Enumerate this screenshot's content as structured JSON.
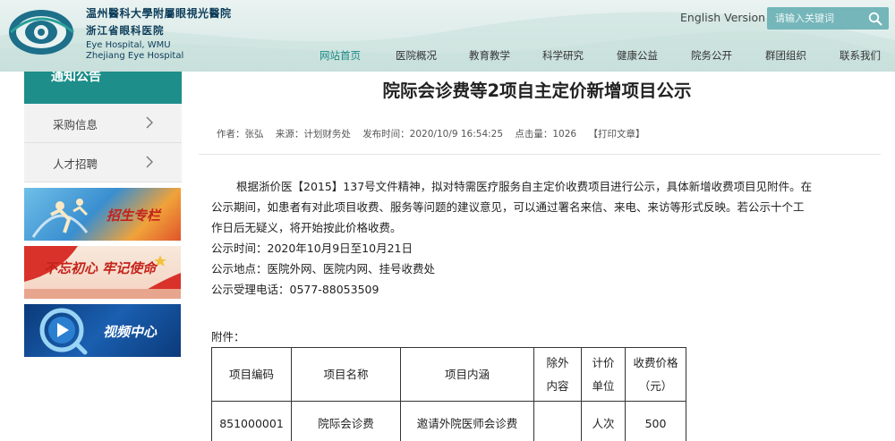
{
  "header": {
    "logo_cn_line1": "温州醫科大學附屬眼視光醫院",
    "logo_cn_line2": "浙江省眼科医院",
    "logo_en_line1": "Eye Hospital, WMU",
    "logo_en_line2": "Zhejiang Eye Hospital",
    "english_version": "English Version",
    "search_placeholder": "请输入关键词",
    "search_icon": "search-icon"
  },
  "nav": {
    "items": [
      "网站首页",
      "医院概况",
      "教育教学",
      "科学研究",
      "健康公益",
      "院务公开",
      "群团组织",
      "联系我们"
    ],
    "active_index": 0
  },
  "sidebar": {
    "heading": "通知公告",
    "items": [
      {
        "label": "采购信息"
      },
      {
        "label": "人才招聘"
      }
    ],
    "banners": [
      {
        "text": "招生专栏"
      },
      {
        "text": "不忘初心 牢记使命"
      },
      {
        "text": "视频中心"
      }
    ]
  },
  "article": {
    "title": "院际会诊费等2项自主定价新增项目公示",
    "meta": {
      "author": "作者：张弘",
      "source": "来源：计划财务处",
      "published": "发布时间：2020/10/9 16:54:25",
      "views": "点击量：1026",
      "print": "【打印文章】"
    },
    "para_lines": [
      "根据浙价医【2015】137号文件精神，拟对特需医疗服务自主定价收费项目进行公示，具体新增收费项目见附件。在",
      "公示期间，如患者有对此项目收费、服务等问题的建议意见，可以通过署名来信、来电、来访等形式反映。若公示十个工",
      "作日后无疑义，将开始按此价格收费。"
    ],
    "period": "公示时间：2020年10月9日至10月21日",
    "place": "公示地点：医院外网、医院内网、挂号收费处",
    "phone": "公示受理电话：0577-88053509",
    "attachment_label": "附件："
  },
  "fee_table": {
    "headers": [
      "项目编码",
      "项目名称",
      "项目内涵",
      "除外内容",
      "计价单位",
      "收费价格（元）"
    ],
    "rows": [
      [
        "851000001",
        "院际会诊费",
        "邀请外院医师会诊费",
        "",
        "人次",
        "500"
      ]
    ]
  },
  "colors": {
    "accent": "#1d8e8a",
    "search_bg": "#74b6ba",
    "sidebar_bg": "#f2f2f2",
    "logo_blue": "#0d3d5a"
  }
}
